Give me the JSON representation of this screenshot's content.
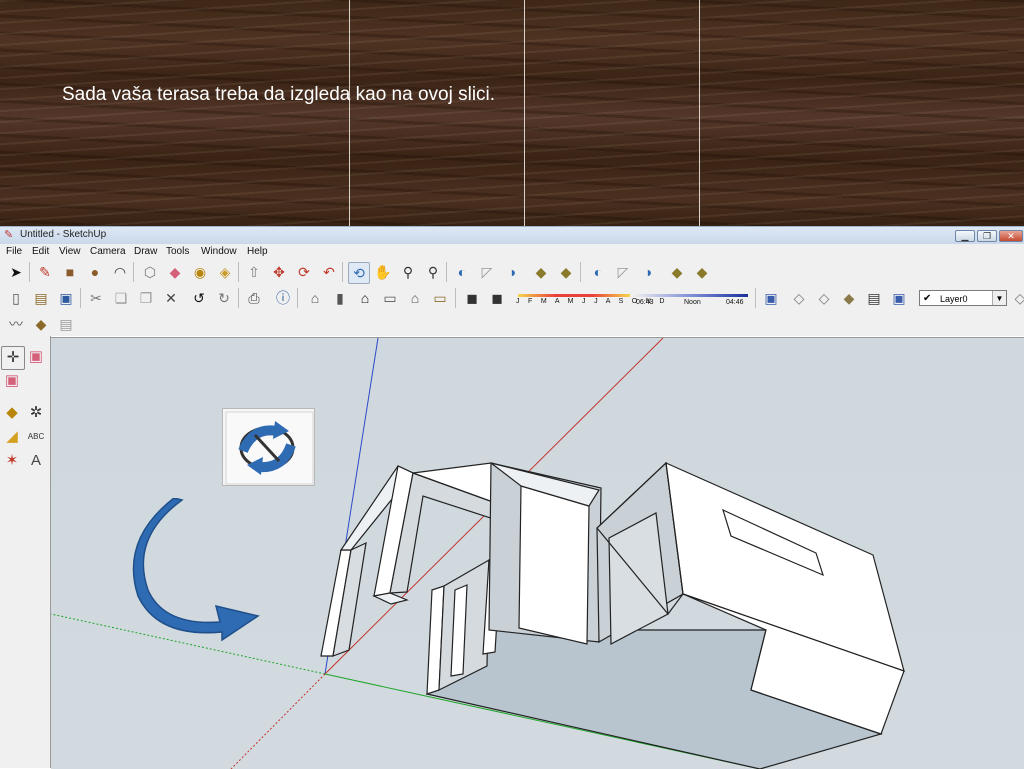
{
  "slide": {
    "caption": "Sada vaša terasa treba da izgleda kao na ovoj slici."
  },
  "window": {
    "title": "Untitled - SketchUp",
    "controls": [
      "minimize",
      "maximize",
      "close"
    ]
  },
  "menu": [
    "File",
    "Edit",
    "View",
    "Camera",
    "Draw",
    "Tools",
    "Window",
    "Help"
  ],
  "shadow_settings": {
    "months": "J F M A M J J A S O N D",
    "time_start": "06:43",
    "time_mid": "Noon",
    "time_end": "04:46"
  },
  "layer": {
    "name": "Layer0",
    "checked": "✔"
  },
  "icons": {
    "toolbar_row1": [
      "select-arrow-icon",
      "pencil-icon",
      "rectangle-icon",
      "circle-icon",
      "arc-icon",
      "polygon-icon",
      "eraser-icon",
      "tape-measure-icon",
      "paint-bucket-icon",
      "push-pull-icon",
      "move-icon",
      "rotate-icon",
      "follow-me-icon",
      "orbit-icon",
      "pan-icon",
      "zoom-icon",
      "zoom-extents-icon",
      "previous-view-icon",
      "next-view-icon",
      "walk-icon",
      "look-around-icon",
      "section-plane-icon",
      "position-camera-icon",
      "layer-stack-icon",
      "extents-icon"
    ],
    "toolbar_row2": [
      "new-file-icon",
      "open-file-icon",
      "save-icon",
      "cut-icon",
      "copy-icon",
      "paste-icon",
      "delete-icon",
      "undo-icon",
      "redo-icon",
      "print-icon",
      "model-info-icon",
      "iso-view-icon",
      "top-view-icon",
      "front-view-icon",
      "right-view-icon",
      "back-view-icon",
      "left-view-icon",
      "shadow-toggle-icon",
      "fog-icon",
      "xray-icon",
      "wireframe-icon",
      "hidden-line-icon",
      "shaded-icon",
      "textured-icon",
      "monochrome-icon"
    ],
    "left_tools": [
      "axes-icon",
      "section-icon",
      "dimension-icon",
      "protractor-icon",
      "text-tool-icon",
      "3d-text-icon",
      "axes-tool-icon",
      "orbit-tool-icon"
    ]
  },
  "colors": {
    "axis_red": "#c4332c",
    "axis_green": "#1ea52a",
    "axis_blue": "#2d49c9",
    "model_face": "#ffffff",
    "model_shadow": "#b8c5cf",
    "viewport_bg": "#d2dadf",
    "callout_arrow": "#2e6bb3"
  }
}
